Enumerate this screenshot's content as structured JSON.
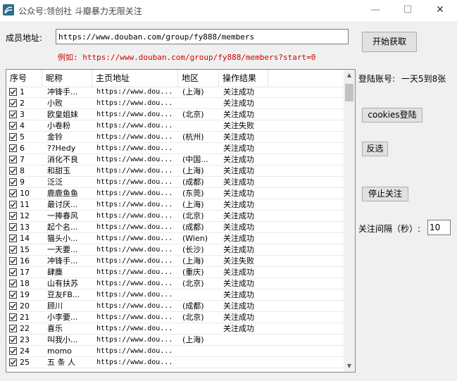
{
  "window": {
    "title": "公众号:领创社 斗瓣暴力无限关注",
    "min_icon": "minimize-icon",
    "max_icon": "maximize-icon",
    "close_icon": "close-icon"
  },
  "form": {
    "member_url_label": "成员地址:",
    "member_url_value": "https://www.douban.com/group/fy888/members",
    "example_text": "例如: https://www.douban.com/group/fy888/members?start=0",
    "start_button": "开始获取"
  },
  "side": {
    "login_account_label": "登陆账号:",
    "login_limit_text": "一天5到8张",
    "cookies_login_button": "cookies登陆",
    "invert_select_button": "反选",
    "stop_follow_button": "停止关注",
    "interval_label": "关注间隔（秒）:",
    "interval_value": "10"
  },
  "table": {
    "columns": [
      "序号",
      "昵称",
      "主页地址",
      "地区",
      "操作结果"
    ],
    "rows": [
      {
        "idx": "1",
        "nick": "冲锋手...",
        "url": "https://www.dou...",
        "region": "(上海)",
        "result": "关注成功",
        "checked": true
      },
      {
        "idx": "2",
        "nick": "小败",
        "url": "https://www.dou...",
        "region": "",
        "result": "关注成功",
        "checked": true
      },
      {
        "idx": "3",
        "nick": "欧皇姐妹",
        "url": "https://www.dou...",
        "region": "(北京)",
        "result": "关注成功",
        "checked": true
      },
      {
        "idx": "4",
        "nick": "小卷粉",
        "url": "https://www.dou...",
        "region": "",
        "result": "关注失败",
        "checked": true
      },
      {
        "idx": "5",
        "nick": "金铃",
        "url": "https://www.dou...",
        "region": "(杭州)",
        "result": "关注成功",
        "checked": true
      },
      {
        "idx": "6",
        "nick": "??Hedy",
        "url": "https://www.dou...",
        "region": "",
        "result": "关注成功",
        "checked": true
      },
      {
        "idx": "7",
        "nick": "消化不良",
        "url": "https://www.dou...",
        "region": "(中国...",
        "result": "关注成功",
        "checked": true
      },
      {
        "idx": "8",
        "nick": "和甜玉",
        "url": "https://www.dou...",
        "region": "(上海)",
        "result": "关注成功",
        "checked": true
      },
      {
        "idx": "9",
        "nick": "泛泛",
        "url": "https://www.dou...",
        "region": "(成都)",
        "result": "关注成功",
        "checked": true
      },
      {
        "idx": "10",
        "nick": "鹿鹿鱼鱼",
        "url": "https://www.dou...",
        "region": "(东莞)",
        "result": "关注成功",
        "checked": true
      },
      {
        "idx": "11",
        "nick": "最讨厌...",
        "url": "https://www.dou...",
        "region": "(上海)",
        "result": "关注成功",
        "checked": true
      },
      {
        "idx": "12",
        "nick": "一捧春风",
        "url": "https://www.dou...",
        "region": "(北京)",
        "result": "关注成功",
        "checked": true
      },
      {
        "idx": "13",
        "nick": "起个名...",
        "url": "https://www.dou...",
        "region": "(成都)",
        "result": "关注成功",
        "checked": true
      },
      {
        "idx": "14",
        "nick": "猫头小...",
        "url": "https://www.dou...",
        "region": "(Wien)",
        "result": "关注成功",
        "checked": true
      },
      {
        "idx": "15",
        "nick": "一天要...",
        "url": "https://www.dou...",
        "region": "(长沙)",
        "result": "关注成功",
        "checked": true
      },
      {
        "idx": "16",
        "nick": "冲锋手...",
        "url": "https://www.dou...",
        "region": "(上海)",
        "result": "关注失败",
        "checked": true
      },
      {
        "idx": "17",
        "nick": "肆麋",
        "url": "https://www.dou...",
        "region": "(重庆)",
        "result": "关注成功",
        "checked": true
      },
      {
        "idx": "18",
        "nick": "山有扶苏",
        "url": "https://www.dou...",
        "region": "(北京)",
        "result": "关注成功",
        "checked": true
      },
      {
        "idx": "19",
        "nick": "豆友FB...",
        "url": "https://www.dou...",
        "region": "",
        "result": "关注成功",
        "checked": true
      },
      {
        "idx": "20",
        "nick": "顾川",
        "url": "https://www.dou...",
        "region": "(成都)",
        "result": "关注成功",
        "checked": true
      },
      {
        "idx": "21",
        "nick": "小李要...",
        "url": "https://www.dou...",
        "region": "(北京)",
        "result": "关注成功",
        "checked": true
      },
      {
        "idx": "22",
        "nick": "喜乐",
        "url": "https://www.dou...",
        "region": "",
        "result": "关注成功",
        "checked": true
      },
      {
        "idx": "23",
        "nick": "叫我小...",
        "url": "https://www.dou...",
        "region": "(上海)",
        "result": "",
        "checked": true
      },
      {
        "idx": "24",
        "nick": "momo",
        "url": "https://www.dou...",
        "region": "",
        "result": "",
        "checked": true
      },
      {
        "idx": "25",
        "nick": "五 条 人",
        "url": "https://www.dou...",
        "region": "",
        "result": "",
        "checked": true
      }
    ]
  },
  "scrollbar": {
    "up_icon": "scroll-up-arrow-icon",
    "down_icon": "scroll-down-arrow-icon"
  }
}
